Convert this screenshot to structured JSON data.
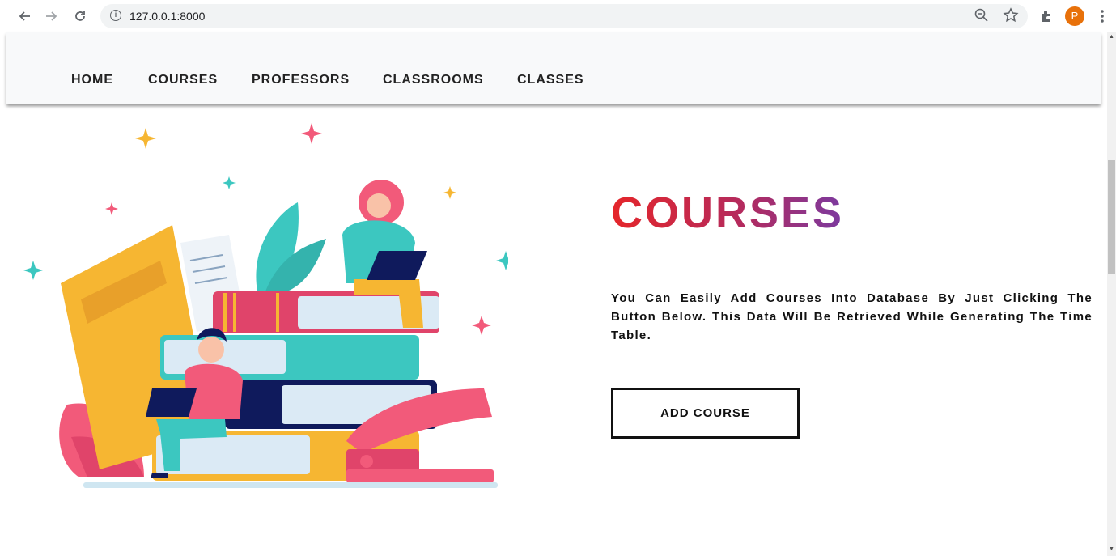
{
  "browser": {
    "url": "127.0.0.1:8000",
    "profile_initial": "P",
    "icons": [
      "back-icon",
      "forward-icon",
      "reload-icon",
      "info-icon",
      "zoom-icon",
      "star-icon",
      "extensions-icon",
      "menu-icon"
    ]
  },
  "nav": {
    "items": [
      {
        "label": "HOME"
      },
      {
        "label": "COURSES"
      },
      {
        "label": "PROFESSORS"
      },
      {
        "label": "CLASSROOMS"
      },
      {
        "label": "CLASSES"
      }
    ]
  },
  "hero": {
    "title": "COURSES",
    "description": "You Can Easily Add Courses Into Database By Just Clicking The Button Below. This Data Will Be Retrieved While Generating The Time Table.",
    "button_label": "ADD COURSE"
  },
  "colors": {
    "title_gradient": [
      "#e5262a",
      "#b52a5c",
      "#7b3aa0"
    ],
    "navbar_bg": "#f8f9fa",
    "avatar_bg": "#e8710a"
  }
}
